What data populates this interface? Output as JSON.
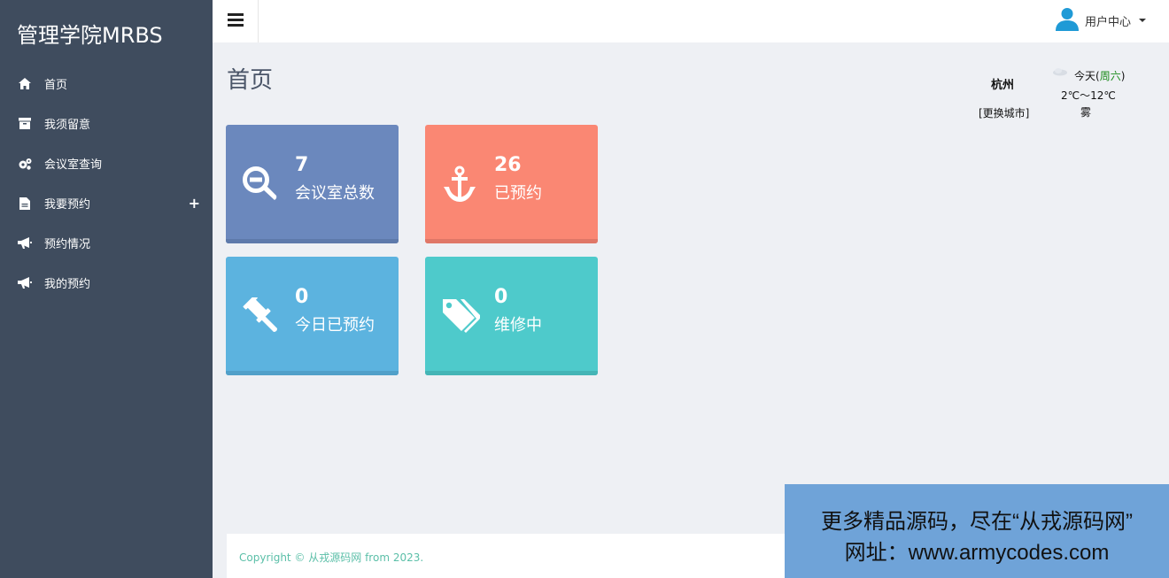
{
  "brand": "管理学院MRBS",
  "sidebar": {
    "items": [
      {
        "label": "首页",
        "icon": "home-icon"
      },
      {
        "label": "我须留意",
        "icon": "archive-icon"
      },
      {
        "label": "会议室查询",
        "icon": "cogs-icon"
      },
      {
        "label": "我要预约",
        "icon": "file-icon",
        "expand": "+"
      },
      {
        "label": "预约情况",
        "icon": "bullhorn-icon"
      },
      {
        "label": "我的预约",
        "icon": "bullhorn-icon"
      }
    ]
  },
  "header": {
    "menu_icon": "bars-icon",
    "user_label": "用户中心",
    "user_icon": "user-icon"
  },
  "page": {
    "title": "首页"
  },
  "weather": {
    "city": "杭州",
    "change_city": "[更换城市]",
    "today_prefix": "今天(",
    "weekday": "周六",
    "today_suffix": ")",
    "temp": "2℃～12℃",
    "condition": "雾"
  },
  "cards": [
    {
      "value": "7",
      "caption": "会议室总数",
      "icon": "search-minus-icon",
      "color": "#6b88bd",
      "bar": "#5e7aab"
    },
    {
      "value": "26",
      "caption": "已预约",
      "icon": "anchor-icon",
      "color": "#fa8773",
      "bar": "#e07767"
    },
    {
      "value": "0",
      "caption": "今日已预约",
      "icon": "gavel-icon",
      "color": "#5cb3df",
      "bar": "#51a0c9"
    },
    {
      "value": "0",
      "caption": "维修中",
      "icon": "tags-icon",
      "color": "#4ecacb",
      "bar": "#44b5b6"
    }
  ],
  "footer": {
    "copyright": "Copyright © 从戎源码网 from 2023."
  },
  "ad": {
    "line1": "更多精品源码，尽在“从戎源码网”",
    "line2": "网址：www.armycodes.com"
  }
}
